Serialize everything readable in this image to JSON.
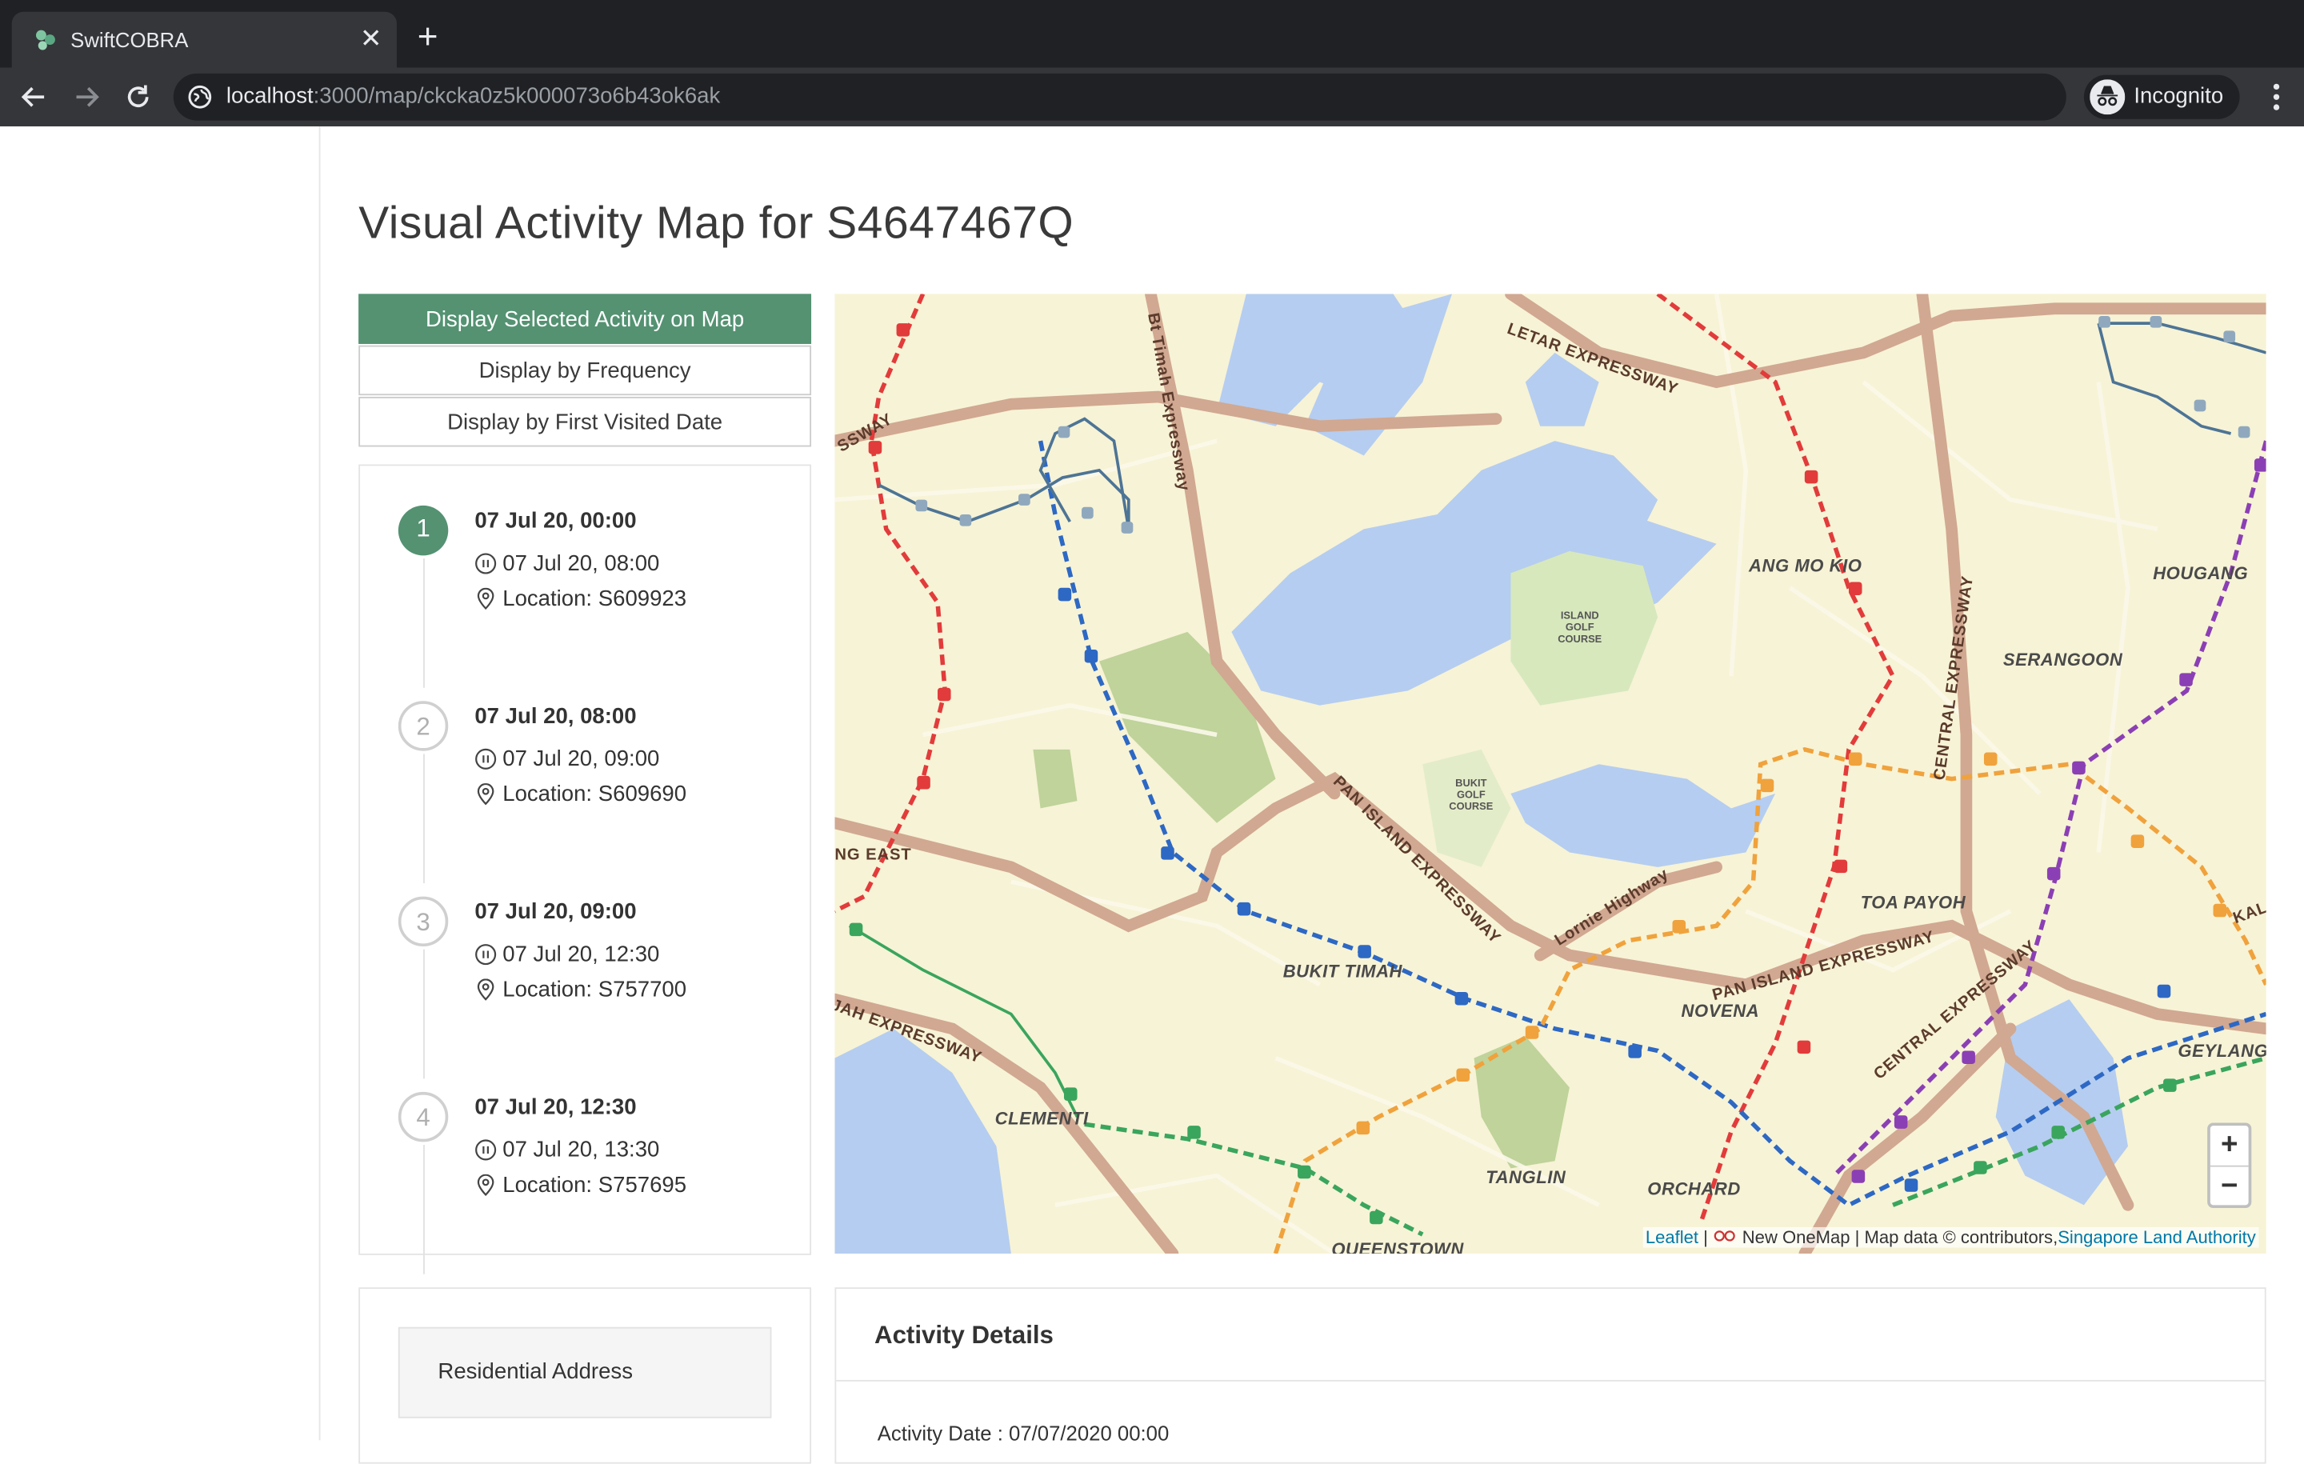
{
  "browser": {
    "tab_title": "SwiftCOBRA",
    "url_host": "localhost",
    "url_path": ":3000/map/ckcka0z5k000073o6b43ok6ak",
    "incognito_label": "Incognito"
  },
  "page": {
    "title": "Visual Activity Map for S4647467Q"
  },
  "controls": {
    "selected_label": "Display Selected Activity on Map",
    "frequency_label": "Display by Frequency",
    "first_visited_label": "Display by First Visited Date"
  },
  "timeline": [
    {
      "index": "1",
      "start": "07 Jul 20, 00:00",
      "end": "07 Jul 20, 08:00",
      "location": "Location: S609923",
      "active": true
    },
    {
      "index": "2",
      "start": "07 Jul 20, 08:00",
      "end": "07 Jul 20, 09:00",
      "location": "Location: S609690",
      "active": false
    },
    {
      "index": "3",
      "start": "07 Jul 20, 09:00",
      "end": "07 Jul 20, 12:30",
      "location": "Location: S757700",
      "active": false
    },
    {
      "index": "4",
      "start": "07 Jul 20, 12:30",
      "end": "07 Jul 20, 13:30",
      "location": "Location: S757695",
      "active": false
    }
  ],
  "map": {
    "place_labels": [
      "ANG MO KIO",
      "HOUGANG",
      "SERANGOON",
      "TOA PAYOH",
      "BUKIT TIMAH",
      "NOVENA",
      "GEYLANG",
      "CLEMENTI",
      "TANGLIN",
      "ORCHARD",
      "QUEENSTOWN"
    ],
    "road_labels": [
      "LETAR EXPRESSWAY",
      "Bt Timah Expressway",
      "PAN ISLAND EXPRESSWAY",
      "CENTRAL EXPRESSWAY",
      "Lornie Highway",
      "NG EAST",
      "JAH EXPRESSWAY",
      "KAL",
      "SSWAY"
    ],
    "small_labels": [
      "ISLAND GOLF COURSE",
      "BUKIT GOLF COURSE"
    ],
    "zoom_in": "+",
    "zoom_out": "−",
    "attribution": {
      "leaflet": "Leaflet",
      "sep": " | ",
      "provider": "New OneMap | Map data © contributors,",
      "authority": "Singapore Land Authority"
    },
    "colors": {
      "land": "#f7f3d6",
      "water": "#b5cdf0",
      "expressway": "#d1a891",
      "park": "#bfd39a",
      "line_red": "#e23b3b",
      "line_blue": "#2d68c4",
      "line_orange": "#f0a23c",
      "line_purple": "#8b3fb4",
      "line_green": "#3aa55d"
    }
  },
  "details": {
    "residential_label": "Residential Address",
    "title": "Activity Details",
    "activity_date": "Activity Date : 07/07/2020 00:00"
  }
}
